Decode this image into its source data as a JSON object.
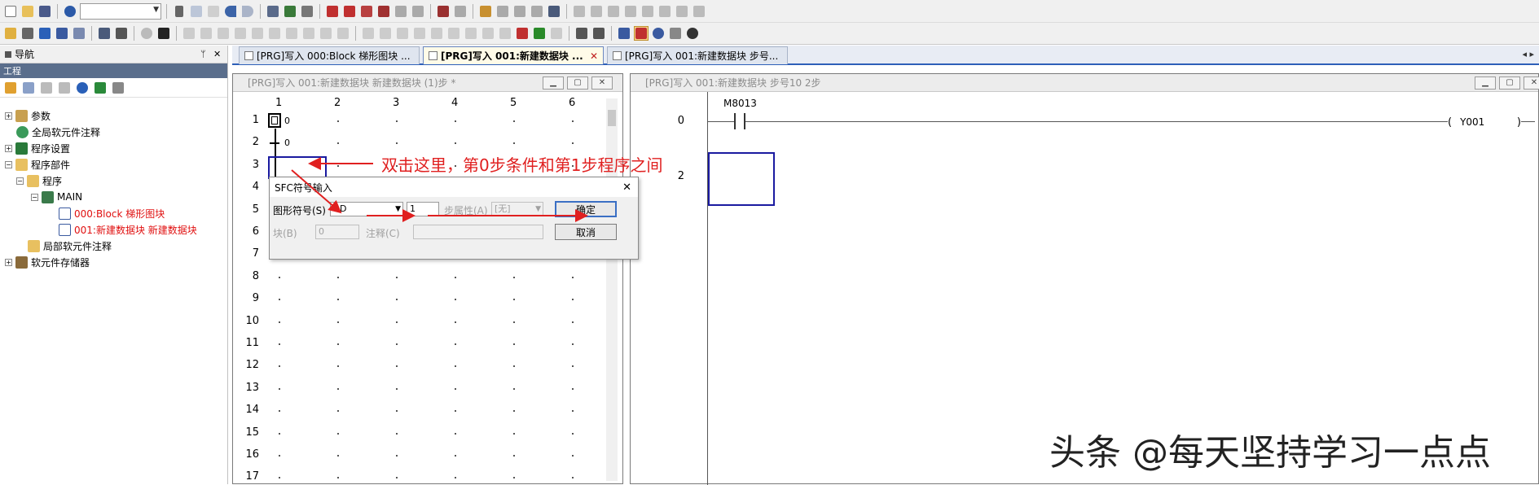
{
  "toolbar": {
    "combo_value": ""
  },
  "nav": {
    "title": "导航",
    "pin": "ᛘ",
    "close": "✕",
    "section": "工程",
    "tree": [
      {
        "label": "参数",
        "expander": "+",
        "level": 0
      },
      {
        "label": "全局软元件注释",
        "expander": "",
        "level": 0
      },
      {
        "label": "程序设置",
        "expander": "+",
        "level": 0
      },
      {
        "label": "程序部件",
        "expander": "−",
        "level": 0
      },
      {
        "label": "程序",
        "expander": "−",
        "level": 1
      },
      {
        "label": "MAIN",
        "expander": "−",
        "level": 2
      },
      {
        "label": "000:Block 梯形图块",
        "expander": "",
        "level": 3,
        "color": "#e01010"
      },
      {
        "label": "001:新建数据块 新建数据块",
        "expander": "",
        "level": 3,
        "color": "#e01010"
      },
      {
        "label": "局部软元件注释",
        "expander": "",
        "level": 1
      },
      {
        "label": "软元件存储器",
        "expander": "+",
        "level": 0
      }
    ]
  },
  "tabs": [
    {
      "label": "[PRG]写入 000:Block 梯形图块 ...",
      "active": false
    },
    {
      "label": "[PRG]写入 001:新建数据块 ...",
      "active": true,
      "close": "✕"
    },
    {
      "label": "[PRG]写入 001:新建数据块 步号...",
      "active": false
    }
  ],
  "tabs_scroll": "◂ ▸",
  "sfc_window": {
    "title": "[PRG]写入 001:新建数据块 新建数据块 (1)步 *",
    "columns": [
      "1",
      "2",
      "3",
      "4",
      "5",
      "6"
    ],
    "rows": [
      "1",
      "2",
      "3",
      "4",
      "5",
      "6",
      "7",
      "8",
      "9",
      "10",
      "11",
      "12",
      "13",
      "14",
      "15",
      "16",
      "17"
    ],
    "step_label": "0",
    "transition_label": "0"
  },
  "ladder_window": {
    "title": "[PRG]写入 001:新建数据块 步号10 2步",
    "row_labels": [
      "0",
      "2"
    ],
    "contact": "M8013",
    "coil": "Y001"
  },
  "dialog": {
    "title": "SFC符号输入",
    "close": "✕",
    "symbol_label": "图形符号(S)",
    "symbol_value": "--D",
    "number_value": "1",
    "step_attr_label": "步属性(A)",
    "step_attr_value": "[无]",
    "block_label": "块(B)",
    "block_value": "0",
    "comment_label": "注释(C)",
    "comment_value": "",
    "ok_label": "确定",
    "cancel_label": "取消"
  },
  "annotation": "双击这里，第0步条件和第1步程序之间",
  "watermark": "头条 @每天坚持学习一点点",
  "colors": {
    "annotation": "#e02020",
    "selection": "#1a1aa0",
    "tab_underline": "#2d5fb8"
  }
}
